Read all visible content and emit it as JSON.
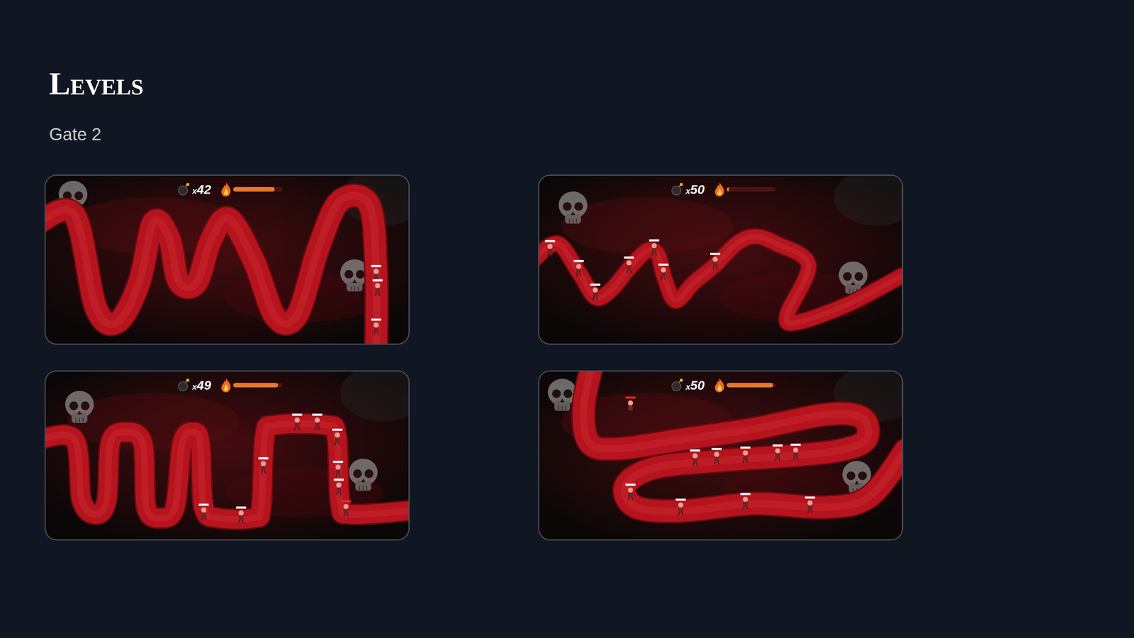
{
  "page": {
    "title": "Levels",
    "subtitle": "Gate 2"
  },
  "levels": [
    {
      "multiplier": "x",
      "count": "42",
      "fire_level": 0.85,
      "enemies": [
        {
          "hurt": false
        },
        {
          "hurt": false
        },
        {
          "hurt": false
        }
      ]
    },
    {
      "multiplier": "x",
      "count": "50",
      "fire_level": 0.05,
      "enemies": [
        {
          "hurt": false
        },
        {
          "hurt": false
        },
        {
          "hurt": false
        },
        {
          "hurt": false
        },
        {
          "hurt": false
        },
        {
          "hurt": false
        },
        {
          "hurt": false
        }
      ]
    },
    {
      "multiplier": "x",
      "count": "49",
      "fire_level": 0.92,
      "enemies": [
        {
          "hurt": false
        },
        {
          "hurt": false
        },
        {
          "hurt": false
        },
        {
          "hurt": false
        },
        {
          "hurt": false
        },
        {
          "hurt": false
        },
        {
          "hurt": false
        },
        {
          "hurt": false
        },
        {
          "hurt": true
        }
      ]
    },
    {
      "multiplier": "x",
      "count": "50",
      "fire_level": 0.95,
      "enemies": [
        {
          "hurt": true
        },
        {
          "hurt": false
        },
        {
          "hurt": false
        },
        {
          "hurt": false
        },
        {
          "hurt": false
        },
        {
          "hurt": false
        },
        {
          "hurt": false
        },
        {
          "hurt": false
        },
        {
          "hurt": false
        },
        {
          "hurt": false
        }
      ]
    }
  ]
}
